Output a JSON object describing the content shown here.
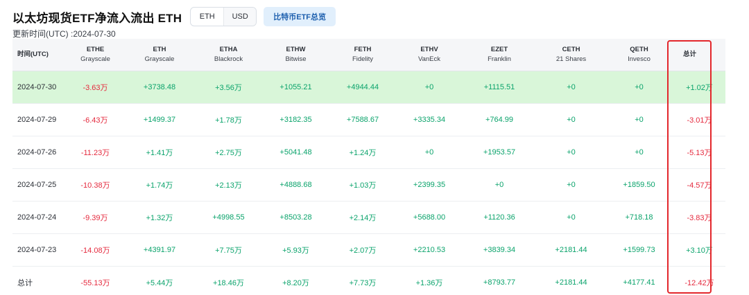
{
  "header": {
    "title": "以太坊现货ETF净流入流出 ETH",
    "unit_toggle": [
      "ETH",
      "USD"
    ],
    "overview_button": "比特币ETF总览"
  },
  "update_time": "更新时间(UTC) :2024-07-30",
  "table": {
    "date_header": "时间(UTC)",
    "columns": [
      {
        "ticker": "ETHE",
        "issuer": "Grayscale"
      },
      {
        "ticker": "ETH",
        "issuer": "Grayscale"
      },
      {
        "ticker": "ETHA",
        "issuer": "Blackrock"
      },
      {
        "ticker": "ETHW",
        "issuer": "Bitwise"
      },
      {
        "ticker": "FETH",
        "issuer": "Fidelity"
      },
      {
        "ticker": "ETHV",
        "issuer": "VanEck"
      },
      {
        "ticker": "EZET",
        "issuer": "Franklin"
      },
      {
        "ticker": "CETH",
        "issuer": "21 Shares"
      },
      {
        "ticker": "QETH",
        "issuer": "Invesco"
      },
      {
        "ticker": "总计",
        "issuer": ""
      }
    ],
    "rows": [
      {
        "date": "2024-07-30",
        "values": [
          "-3.63万",
          "+3738.48",
          "+3.56万",
          "+1055.21",
          "+4944.44",
          "+0",
          "+1115.51",
          "+0",
          "+0",
          "+1.02万"
        ]
      },
      {
        "date": "2024-07-29",
        "values": [
          "-6.43万",
          "+1499.37",
          "+1.78万",
          "+3182.35",
          "+7588.67",
          "+3335.34",
          "+764.99",
          "+0",
          "+0",
          "-3.01万"
        ]
      },
      {
        "date": "2024-07-26",
        "values": [
          "-11.23万",
          "+1.41万",
          "+2.75万",
          "+5041.48",
          "+1.24万",
          "+0",
          "+1953.57",
          "+0",
          "+0",
          "-5.13万"
        ]
      },
      {
        "date": "2024-07-25",
        "values": [
          "-10.38万",
          "+1.74万",
          "+2.13万",
          "+4888.68",
          "+1.03万",
          "+2399.35",
          "+0",
          "+0",
          "+1859.50",
          "-4.57万"
        ]
      },
      {
        "date": "2024-07-24",
        "values": [
          "-9.39万",
          "+1.32万",
          "+4998.55",
          "+8503.28",
          "+2.14万",
          "+5688.00",
          "+1120.36",
          "+0",
          "+718.18",
          "-3.83万"
        ]
      },
      {
        "date": "2024-07-23",
        "values": [
          "-14.08万",
          "+4391.97",
          "+7.75万",
          "+5.93万",
          "+2.07万",
          "+2210.53",
          "+3839.34",
          "+2181.44",
          "+1599.73",
          "+3.10万"
        ]
      }
    ],
    "total_row": {
      "label": "总计",
      "values": [
        "-55.13万",
        "+5.44万",
        "+18.46万",
        "+8.20万",
        "+7.73万",
        "+1.36万",
        "+8793.77",
        "+2181.44",
        "+4177.41",
        "-12.42万"
      ]
    }
  },
  "colors": {
    "positive": "#0aa36b",
    "negative": "#e5293d",
    "highlight_row": "#d9f6d9",
    "total_column_outline": "#e3262b"
  }
}
